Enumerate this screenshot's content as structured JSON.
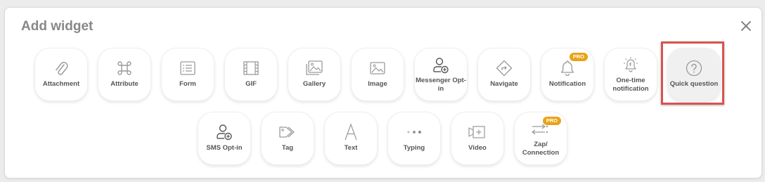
{
  "dialog": {
    "title": "Add widget",
    "close_icon": "close-icon"
  },
  "row1": [
    {
      "id": "attachment",
      "label": "Attachment",
      "icon": "paperclip-icon"
    },
    {
      "id": "attribute",
      "label": "Attribute",
      "icon": "command-icon"
    },
    {
      "id": "form",
      "label": "Form",
      "icon": "form-list-icon"
    },
    {
      "id": "gif",
      "label": "GIF",
      "icon": "film-icon"
    },
    {
      "id": "gallery",
      "label": "Gallery",
      "icon": "gallery-icon"
    },
    {
      "id": "image",
      "label": "Image",
      "icon": "image-icon"
    },
    {
      "id": "messenger-opt-in",
      "label": "Messenger Opt-in",
      "icon": "user-add-icon"
    },
    {
      "id": "navigate",
      "label": "Navigate",
      "icon": "navigate-icon"
    },
    {
      "id": "notification",
      "label": "Notification",
      "icon": "bell-icon",
      "badge": "PRO"
    },
    {
      "id": "one-time-notification",
      "label": "One-time notification",
      "icon": "alert-bell-icon"
    },
    {
      "id": "quick-question",
      "label": "Quick question",
      "icon": "question-circle-icon",
      "selected": true
    }
  ],
  "row2": [
    {
      "id": "sms-opt-in",
      "label": "SMS Opt-in",
      "icon": "user-add-icon"
    },
    {
      "id": "tag",
      "label": "Tag",
      "icon": "tag-icon"
    },
    {
      "id": "text",
      "label": "Text",
      "icon": "text-a-icon"
    },
    {
      "id": "typing",
      "label": "Typing",
      "icon": "typing-dots-icon"
    },
    {
      "id": "video",
      "label": "Video",
      "icon": "video-add-icon"
    },
    {
      "id": "zap-connection",
      "label": "Zap/ Connection",
      "icon": "zap-connection-icon",
      "badge": "PRO"
    }
  ],
  "colors": {
    "badge": "#e8a317",
    "highlight": "#d9534f",
    "icon": "#9a9a9a",
    "label": "#555555"
  }
}
